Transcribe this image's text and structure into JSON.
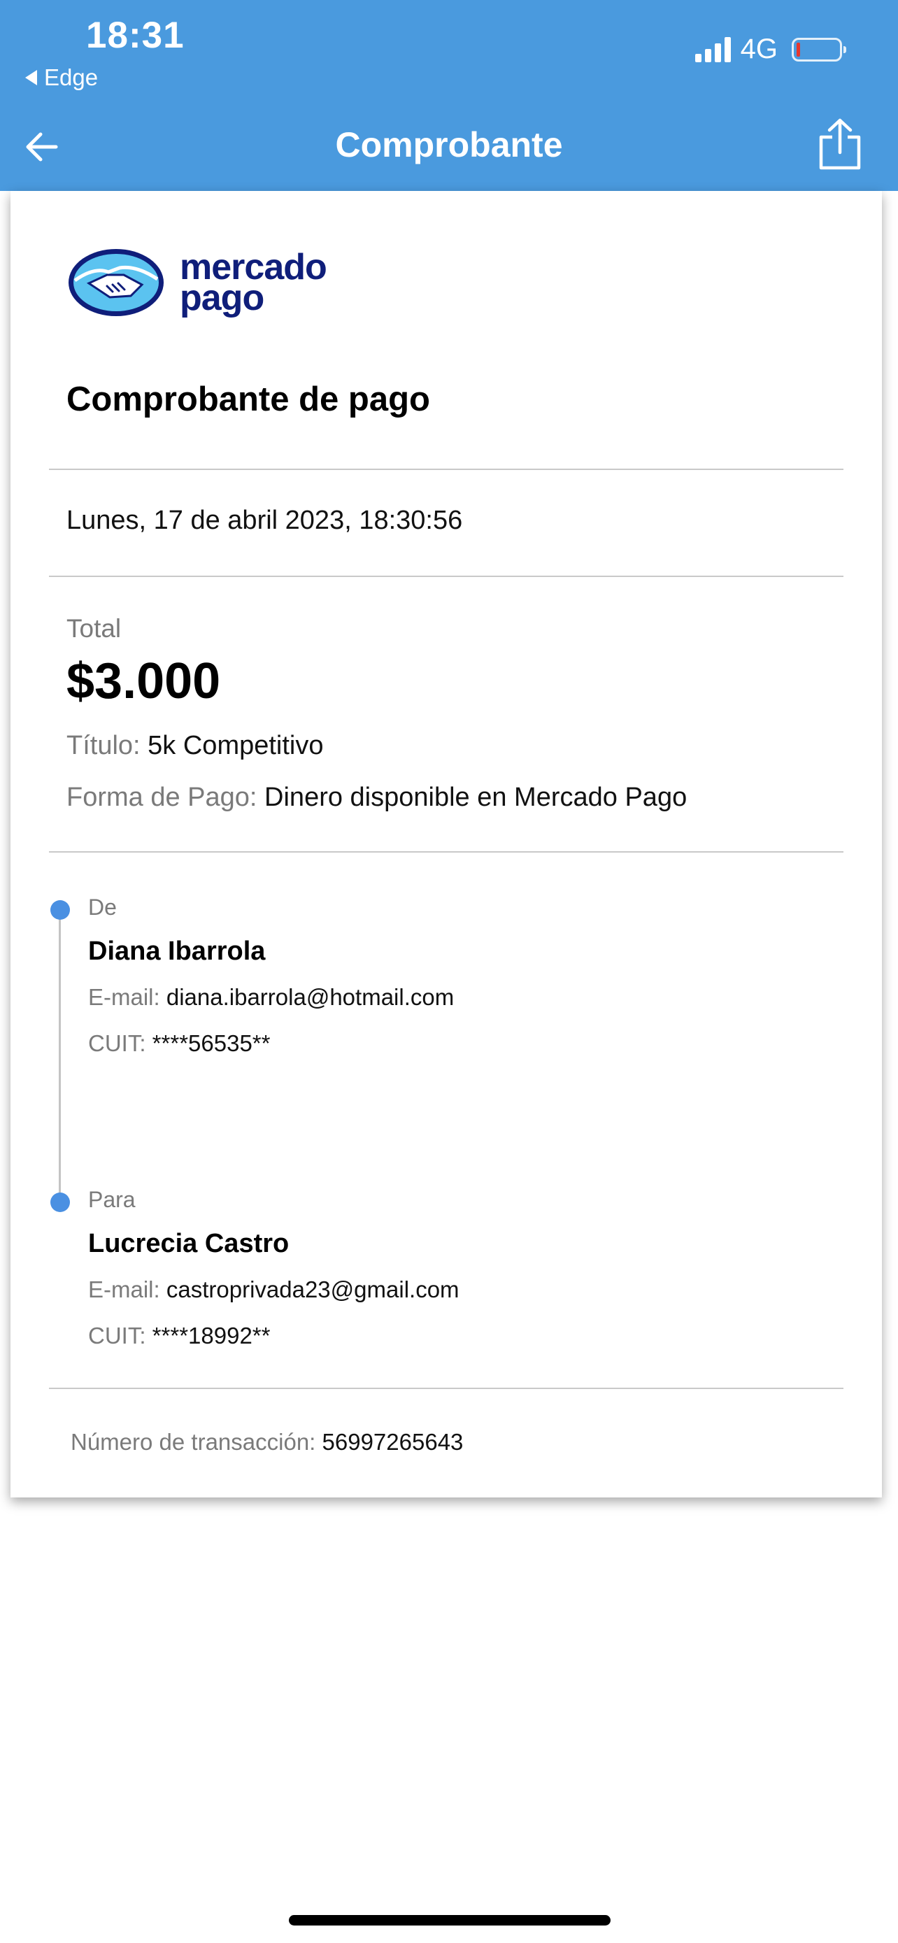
{
  "status_bar": {
    "time": "18:31",
    "back_app": "Edge",
    "network": "4G",
    "icons": [
      "signal-icon",
      "battery-icon"
    ]
  },
  "nav": {
    "title": "Comprobante",
    "back_icon": "arrow-left-icon",
    "share_icon": "share-icon"
  },
  "receipt": {
    "logo_text_line1": "mercado",
    "logo_text_line2": "pago",
    "title": "Comprobante de pago",
    "date": "Lunes, 17 de abril 2023, 18:30:56",
    "total_label": "Total",
    "total_amount": "$3.000",
    "titulo_label": "Título:",
    "titulo_value": "5k Competitivo",
    "forma_label": "Forma de Pago:",
    "forma_value": "Dinero disponible en Mercado Pago",
    "from": {
      "role": "De",
      "name": "Diana Ibarrola",
      "email_label": "E-mail:",
      "email": "diana.ibarrola@hotmail.com",
      "cuit_label": "CUIT:",
      "cuit": "****56535**"
    },
    "to": {
      "role": "Para",
      "name": "Lucrecia Castro",
      "email_label": "E-mail:",
      "email": "castroprivada23@gmail.com",
      "cuit_label": "CUIT:",
      "cuit": "****18992**"
    },
    "transaction_label": "Número de transacción:",
    "transaction_number": "56997265643"
  },
  "colors": {
    "header_bg": "#4a9ade",
    "accent_dot": "#4a90e2",
    "logo_navy": "#0f1e7a",
    "logo_light_blue": "#5bc3f0"
  }
}
